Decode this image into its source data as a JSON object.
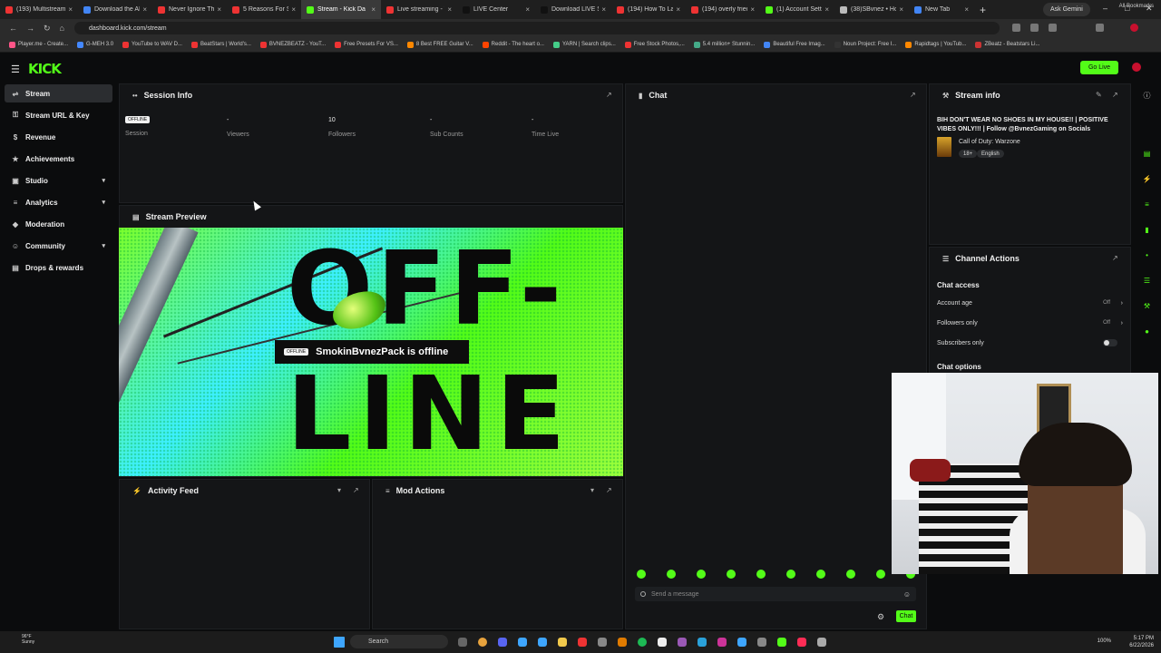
{
  "browser": {
    "tabs": [
      {
        "label": "(193) Multistream",
        "color": "#e33"
      },
      {
        "label": "Download the AI",
        "color": "#4285f4"
      },
      {
        "label": "Never Ignore This",
        "color": "#e33"
      },
      {
        "label": "5 Reasons For So",
        "color": "#e33"
      },
      {
        "label": "Stream - Kick Da",
        "color": "#53fc18",
        "active": true
      },
      {
        "label": "Live streaming - Y",
        "color": "#e33"
      },
      {
        "label": "LIVE Center",
        "color": "#111"
      },
      {
        "label": "Download LIVE St",
        "color": "#111"
      },
      {
        "label": "(194) How To Lay",
        "color": "#e33"
      },
      {
        "label": "(194) overly fried",
        "color": "#e33"
      },
      {
        "label": "(1) Account Settin",
        "color": "#53fc18"
      },
      {
        "label": "(38)SBvnez • Ho",
        "color": "#bbb"
      },
      {
        "label": "New Tab",
        "color": "#4285f4"
      }
    ],
    "ask_gemini": "Ask Gemini",
    "url": "dashboard.kick.com/stream",
    "bookmarks": [
      {
        "label": "Player.me - Create...",
        "color": "#f58"
      },
      {
        "label": "G-MEH 3.0",
        "color": "#48f"
      },
      {
        "label": "YouTube to WAV D...",
        "color": "#e33"
      },
      {
        "label": "BeatStars | World's...",
        "color": "#e33"
      },
      {
        "label": "BVNEZBEATZ - YouT...",
        "color": "#e33"
      },
      {
        "label": "Free Presets For VS...",
        "color": "#e33"
      },
      {
        "label": "8 Best FREE Guitar V...",
        "color": "#f80"
      },
      {
        "label": "Reddit - The heart o...",
        "color": "#f40"
      },
      {
        "label": "YARN | Search clips...",
        "color": "#4c8"
      },
      {
        "label": "Free Stock Photos,...",
        "color": "#e33"
      },
      {
        "label": "5.4 million+ Stunnin...",
        "color": "#4a8"
      },
      {
        "label": "Beautiful Free Imag...",
        "color": "#4285f4"
      },
      {
        "label": "Noun Project: Free I...",
        "color": "#333"
      },
      {
        "label": "Rapidtags | YouTub...",
        "color": "#f80"
      },
      {
        "label": "ZBeatz - Beatstars Li...",
        "color": "#c33"
      }
    ],
    "all_bookmarks": "All Bookmarks"
  },
  "kick": {
    "logo": "KICK",
    "go_live": "Go Live"
  },
  "sidebar": {
    "items": [
      {
        "label": "Stream",
        "icon": "broadcast-icon",
        "glyph": "⇌",
        "active": true
      },
      {
        "label": "Stream URL & Key",
        "icon": "key-icon",
        "glyph": "⚿"
      },
      {
        "label": "Revenue",
        "icon": "dollar-icon",
        "glyph": "$"
      },
      {
        "label": "Achievements",
        "icon": "trophy-icon",
        "glyph": "★"
      },
      {
        "label": "Studio",
        "icon": "studio-icon",
        "glyph": "▣",
        "expandable": true
      },
      {
        "label": "Analytics",
        "icon": "chart-icon",
        "glyph": "≡",
        "expandable": true
      },
      {
        "label": "Moderation",
        "icon": "shield-icon",
        "glyph": "◆"
      },
      {
        "label": "Community",
        "icon": "people-icon",
        "glyph": "☺",
        "expandable": true
      },
      {
        "label": "Drops & rewards",
        "icon": "gift-icon",
        "glyph": "▤"
      }
    ]
  },
  "session": {
    "title": "Session Info",
    "badge": "OFFLINE",
    "stats": [
      {
        "value": "",
        "label": "Session"
      },
      {
        "value": "-",
        "label": "Viewers"
      },
      {
        "value": "10",
        "label": "Followers"
      },
      {
        "value": "-",
        "label": "Sub Counts"
      },
      {
        "value": "-",
        "label": "Time Live"
      }
    ]
  },
  "preview": {
    "title": "Stream Preview",
    "badge": "OFFLINE",
    "status": "SmokinBvnezPack is offline",
    "big_text_1": "OFF-",
    "big_text_2": "LINE"
  },
  "activity": {
    "title": "Activity Feed"
  },
  "mod_actions": {
    "title": "Mod Actions"
  },
  "chat": {
    "title": "Chat",
    "placeholder": "Send a message",
    "send_label": "Chat"
  },
  "stream_info": {
    "title": "Stream info",
    "stream_title": "BIH DON'T WEAR NO SHOES IN MY HOUSE!! | POSITIVE VIBES ONLY!!! | Follow @BvnezGaming on Socials",
    "game": "Call of Duty: Warzone",
    "tags": [
      "18+",
      "English"
    ]
  },
  "channel_actions": {
    "title": "Channel Actions",
    "chat_access": "Chat access",
    "rows": [
      {
        "label": "Account age",
        "value": "Off"
      },
      {
        "label": "Followers only",
        "value": "Off"
      },
      {
        "label": "Subscribers only",
        "value": ""
      }
    ],
    "chat_options": "Chat options"
  },
  "taskbar": {
    "weather_temp": "96°F",
    "weather_desc": "Sunny",
    "search": "Search",
    "time": "5:17 PM",
    "date": "6/22/2026",
    "battery": "100%"
  }
}
